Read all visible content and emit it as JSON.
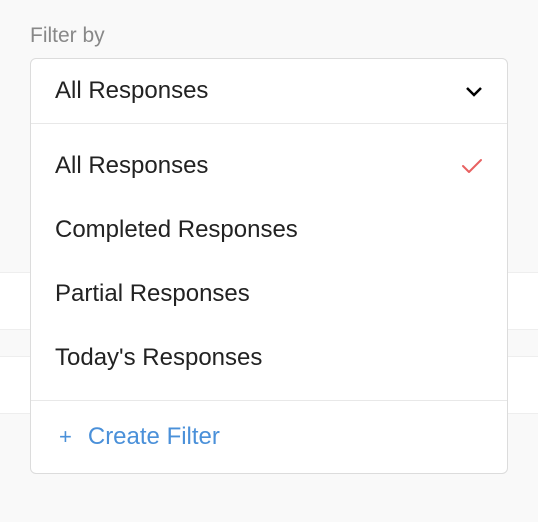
{
  "filter": {
    "label": "Filter by",
    "selected": "All Responses",
    "options": [
      {
        "label": "All Responses",
        "selected": true
      },
      {
        "label": "Completed Responses",
        "selected": false
      },
      {
        "label": "Partial Responses",
        "selected": false
      },
      {
        "label": "Today's Responses",
        "selected": false
      }
    ],
    "createAction": "Create Filter"
  }
}
